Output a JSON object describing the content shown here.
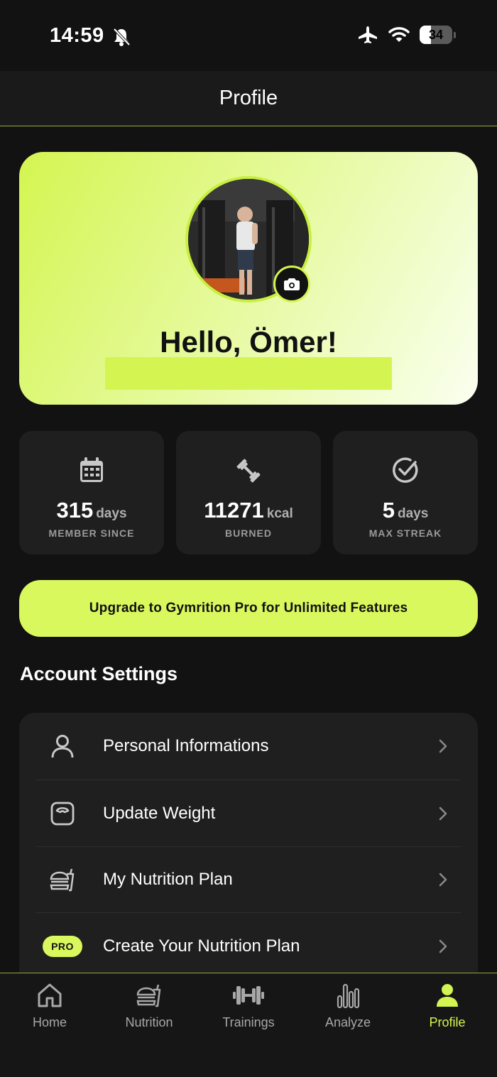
{
  "status_bar": {
    "time": "14:59",
    "battery_percent": "34",
    "battery_level": 0.34,
    "icons": [
      "bell-slash-icon",
      "airplane-icon",
      "wifi-icon",
      "battery-icon"
    ]
  },
  "header": {
    "title": "Profile"
  },
  "hero": {
    "greeting": "Hello, Ömer!",
    "avatar_icon": "camera-icon"
  },
  "stats": [
    {
      "icon": "calendar-icon",
      "value": "315",
      "unit": "days",
      "label": "MEMBER SINCE"
    },
    {
      "icon": "dumbbell-icon",
      "value": "11271",
      "unit": "kcal",
      "label": "BURNED"
    },
    {
      "icon": "check-circle-icon",
      "value": "5",
      "unit": "days",
      "label": "MAX STREAK"
    }
  ],
  "upgrade": {
    "label": "Upgrade to Gymrition Pro for Unlimited Features"
  },
  "account_settings": {
    "title": "Account Settings",
    "items": [
      {
        "icon": "person-icon",
        "label": "Personal Informations"
      },
      {
        "icon": "scale-icon",
        "label": "Update Weight"
      },
      {
        "icon": "meal-plan-icon",
        "label": "My Nutrition Plan"
      },
      {
        "icon": "pro-badge",
        "badge": "PRO",
        "label": "Create Your Nutrition Plan"
      }
    ]
  },
  "tabs": [
    {
      "icon": "home-icon",
      "label": "Home",
      "active": false
    },
    {
      "icon": "nutrition-icon",
      "label": "Nutrition",
      "active": false
    },
    {
      "icon": "dumbbell-icon",
      "label": "Trainings",
      "active": false
    },
    {
      "icon": "bar-chart-icon",
      "label": "Analyze",
      "active": false
    },
    {
      "icon": "person-icon",
      "label": "Profile",
      "active": true
    }
  ],
  "colors": {
    "accent": "#d9f85d",
    "background": "#121212",
    "card": "#1f1f1f",
    "muted_text": "#9a9a9a"
  }
}
